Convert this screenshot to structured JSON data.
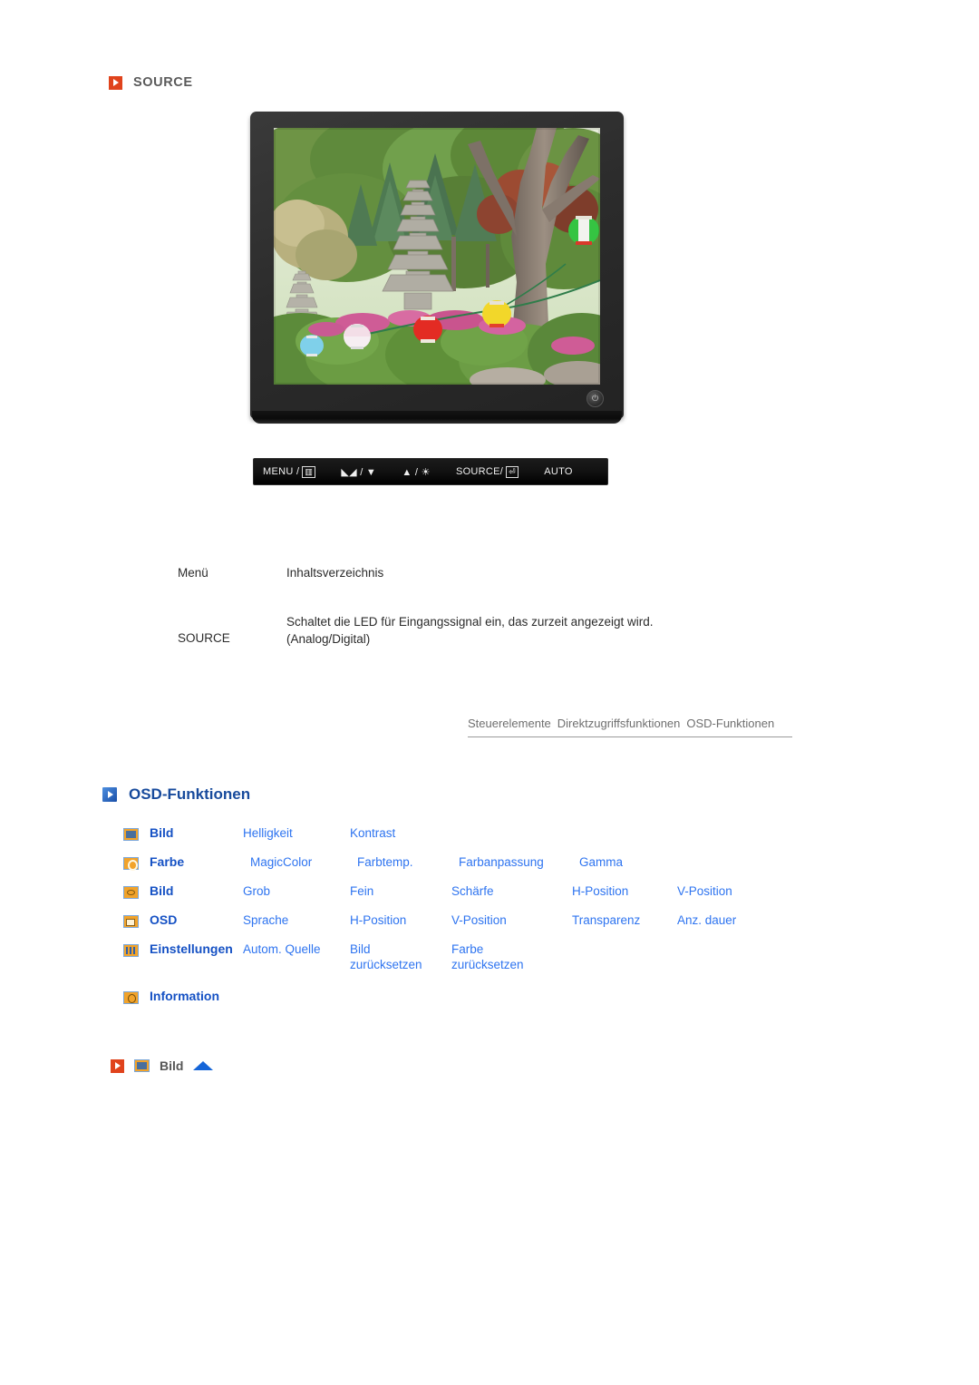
{
  "section": {
    "icon": "play-badge-icon",
    "title": "SOURCE"
  },
  "monitor": {
    "power_glyph": "⏻",
    "screen_alt": "Garten mit Steinpagoden und bunten Papierlaternen"
  },
  "button_bar": {
    "items": [
      {
        "label": "MENU /",
        "glyph": "▥"
      },
      {
        "label": "",
        "glyph": "◣◢ / ▼"
      },
      {
        "label": "",
        "glyph": "▲ / ☀"
      },
      {
        "label": "SOURCE/",
        "glyph": "⏎"
      },
      {
        "label": "AUTO",
        "glyph": ""
      }
    ]
  },
  "description_table": {
    "headers": {
      "menu": "Menü",
      "contents": "Inhaltsverzeichnis"
    },
    "rows": [
      {
        "menu": "SOURCE",
        "contents": "Schaltet die LED für Eingangssignal ein, das zurzeit angezeigt wird.\n(Analog/Digital)"
      }
    ]
  },
  "breadcrumbs": [
    "Steuerelemente",
    "Direktzugriffsfunktionen",
    "OSD-Funktionen"
  ],
  "osd_section": {
    "icon": "blue-play-badge-icon",
    "title": "OSD-Funktionen"
  },
  "osd_table": {
    "rows": [
      {
        "icon": "picture-icon",
        "label": "Bild",
        "cells": [
          "Helligkeit",
          "Kontrast"
        ]
      },
      {
        "icon": "color-icon",
        "label": "Farbe",
        "cells": [
          "MagicColor",
          "Farbtemp.",
          "Farbanpassung",
          "Gamma"
        ]
      },
      {
        "icon": "image-icon",
        "label": "Bild",
        "cells": [
          "Grob",
          "Fein",
          "Schärfe",
          "H-Position",
          "V-Position"
        ]
      },
      {
        "icon": "osd-icon",
        "label": "OSD",
        "cells": [
          "Sprache",
          "H-Position",
          "V-Position",
          "Transparenz",
          "Anz. dauer"
        ]
      },
      {
        "icon": "setup-icon",
        "label": "Einstellungen",
        "cells": [
          "Autom. Quelle",
          "Bild\nzurücksetzen",
          "Farbe\nzurücksetzen"
        ]
      },
      {
        "icon": "info-icon",
        "label": "Information",
        "cells": []
      }
    ]
  },
  "bottom_anchor": {
    "play_icon": "play-badge-icon",
    "section_icon": "picture-icon",
    "label": "Bild",
    "up_icon": "up-triangle-icon"
  },
  "colors": {
    "orange": "#e0431c",
    "link_blue": "#2e74f0",
    "label_blue": "#1551c4",
    "heading_blue": "#174a9c",
    "gray_text": "#5a5a5a"
  }
}
